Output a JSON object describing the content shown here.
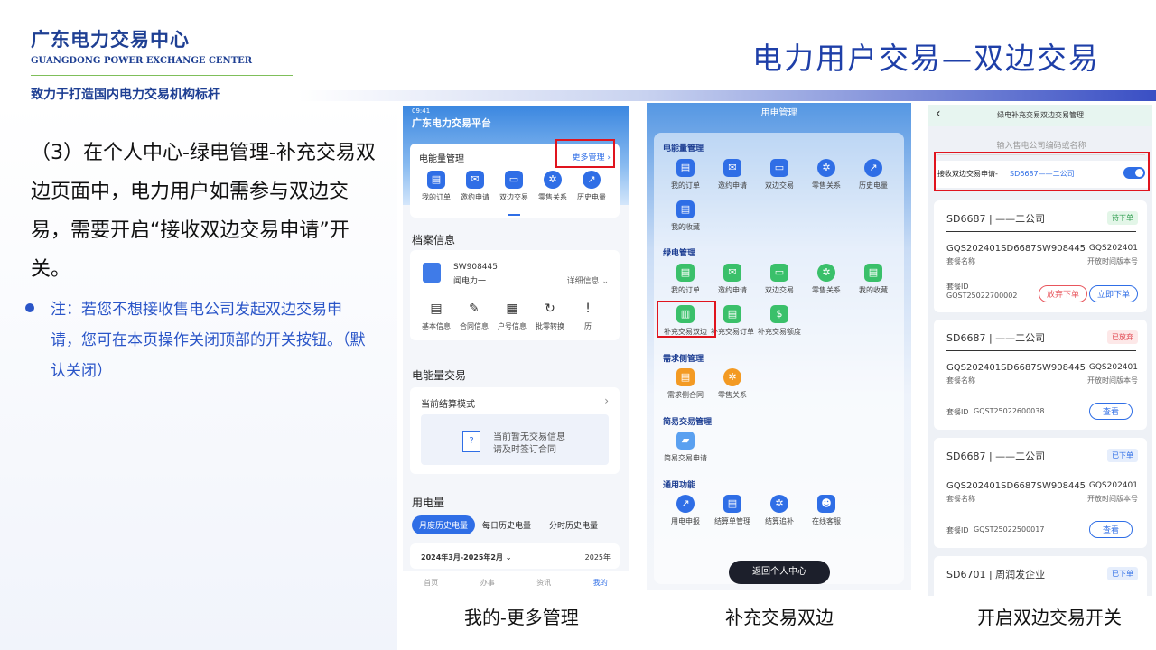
{
  "header": {
    "brand_cn": "广东电力交易中心",
    "brand_en": "GUANGDONG POWER EXCHANGE CENTER",
    "slogan": "致力于打造国内电力交易机构标杆",
    "page_title": "电力用户交易—双边交易"
  },
  "content": {
    "main_text": "（3）在个人中心-绿电管理-补充交易双边页面中，电力用户如需参与双边交易，需要开启“接收双边交易申请”开关。",
    "note": "注：若您不想接收售电公司发起双边交易申请，您可在本页操作关闭顶部的开关按钮。（默认关闭）"
  },
  "captions": [
    "我的-更多管理",
    "补充交易双边",
    "开启双边交易开关"
  ],
  "phone1": {
    "status": "09:41",
    "platform": "广东电力交易平台",
    "energy_mgmt": "电能量管理",
    "more_mgmt": "更多管理 ›",
    "icons": [
      "我的订单",
      "邀约申请",
      "双边交易",
      "零售关系",
      "历史电量"
    ],
    "archive_title": "档案信息",
    "account_id": "SW908445",
    "account_name": "闻电力一",
    "detail": "详细信息 ⌄",
    "archive_icons": [
      "基本信息",
      "合同信息",
      "户号信息",
      "批零转换",
      "历"
    ],
    "trade_title": "电能量交易",
    "settle_mode": "当前结算模式",
    "no_info_1": "当前暂无交易信息",
    "no_info_2": "请及时签订合同",
    "usage_title": "用电量",
    "usage_tabs": [
      "月度历史电量",
      "每日历史电量",
      "分时历史电量"
    ],
    "range": "2024年3月-2025年2月 ⌄",
    "year": "2025年",
    "bottom_nav": [
      "首页",
      "办事",
      "资讯",
      "我的"
    ]
  },
  "phone2": {
    "title": "用电管理",
    "sec_energy": "电能量管理",
    "energy_icons": [
      "我的订单",
      "邀约申请",
      "双边交易",
      "零售关系",
      "历史电量",
      "我的收藏"
    ],
    "sec_green": "绿电管理",
    "green_icons": [
      "我的订单",
      "邀约申请",
      "双边交易",
      "零售关系",
      "我的收藏",
      "补充交易双边",
      "补充交易订单",
      "补充交易额度"
    ],
    "sec_demand": "需求侧管理",
    "demand_icons": [
      "需求侧合同",
      "零售关系"
    ],
    "sec_simple": "简易交易管理",
    "simple_icons": [
      "简易交易申请"
    ],
    "sec_common": "通用功能",
    "common_icons": [
      "用电申报",
      "结算单管理",
      "结算追补",
      "在线客服"
    ],
    "back_button": "返回个人中心"
  },
  "phone3": {
    "title": "绿电补充交易双边交易管理",
    "search_placeholder": "输入售电公司编码或名称",
    "toggle_label": "接收双边交易申请-",
    "toggle_company": "SD6687——二公司",
    "toggle_on": true,
    "cards": [
      {
        "company": "SD6687 | ——二公司",
        "status": "待下单",
        "code": "GQS202401SD6687SW908445",
        "code_right": "GQS202401",
        "sub_left": "套餐名称",
        "sub_right": "开放时间版本号",
        "id_label": "套餐ID",
        "id": "GQST25022700002",
        "buttons": [
          "放弃下单",
          "立即下单"
        ]
      },
      {
        "company": "SD6687 | ——二公司",
        "status": "已放弃",
        "code": "GQS202401SD6687SW908445",
        "code_right": "GQS202401",
        "sub_left": "套餐名称",
        "sub_right": "开放时间版本号",
        "id_label": "套餐ID",
        "id": "GQST25022600038",
        "buttons": [
          "查看"
        ]
      },
      {
        "company": "SD6687 | ——二公司",
        "status": "已下单",
        "code": "GQS202401SD6687SW908445",
        "code_right": "GQS202401",
        "sub_left": "套餐名称",
        "sub_right": "开放时间版本号",
        "id_label": "套餐ID",
        "id": "GQST25022500017",
        "buttons": [
          "查看"
        ]
      },
      {
        "company": "SD6701 | 周润发企业",
        "status": "已下单"
      }
    ]
  },
  "colors": {
    "brand": "#1e3f93",
    "accent": "#2f6ee6",
    "red": "#e0141e"
  }
}
